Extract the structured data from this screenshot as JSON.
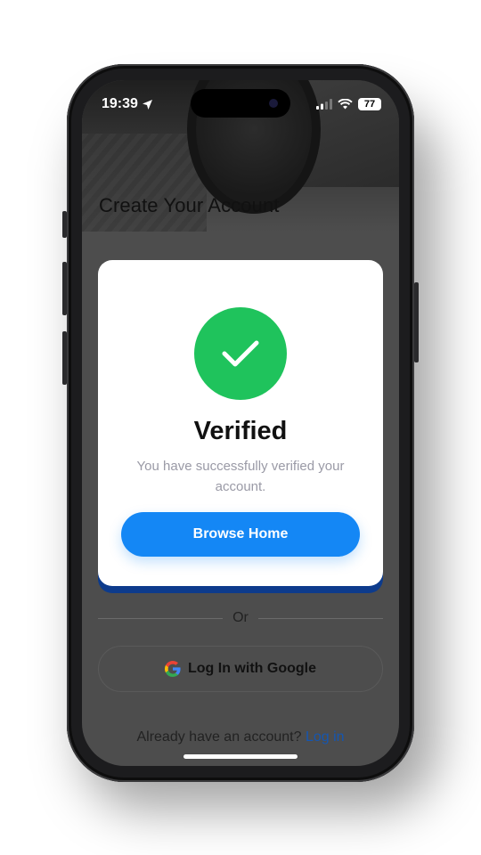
{
  "status_bar": {
    "time": "19:39",
    "battery": "77"
  },
  "page": {
    "title": "Create Your Account",
    "divider_text": "Or",
    "google_button_label": "Log In with Google",
    "footer_text": "Already have an account?",
    "footer_link": "Log in"
  },
  "modal": {
    "title": "Verified",
    "message": "You have successfully verified your account.",
    "button_label": "Browse Home",
    "icon": "checkmark-icon"
  },
  "colors": {
    "accent": "#1487F5",
    "success": "#1FC35C",
    "dim_overlay": "#4D4D4D",
    "link": "#1556B0"
  }
}
